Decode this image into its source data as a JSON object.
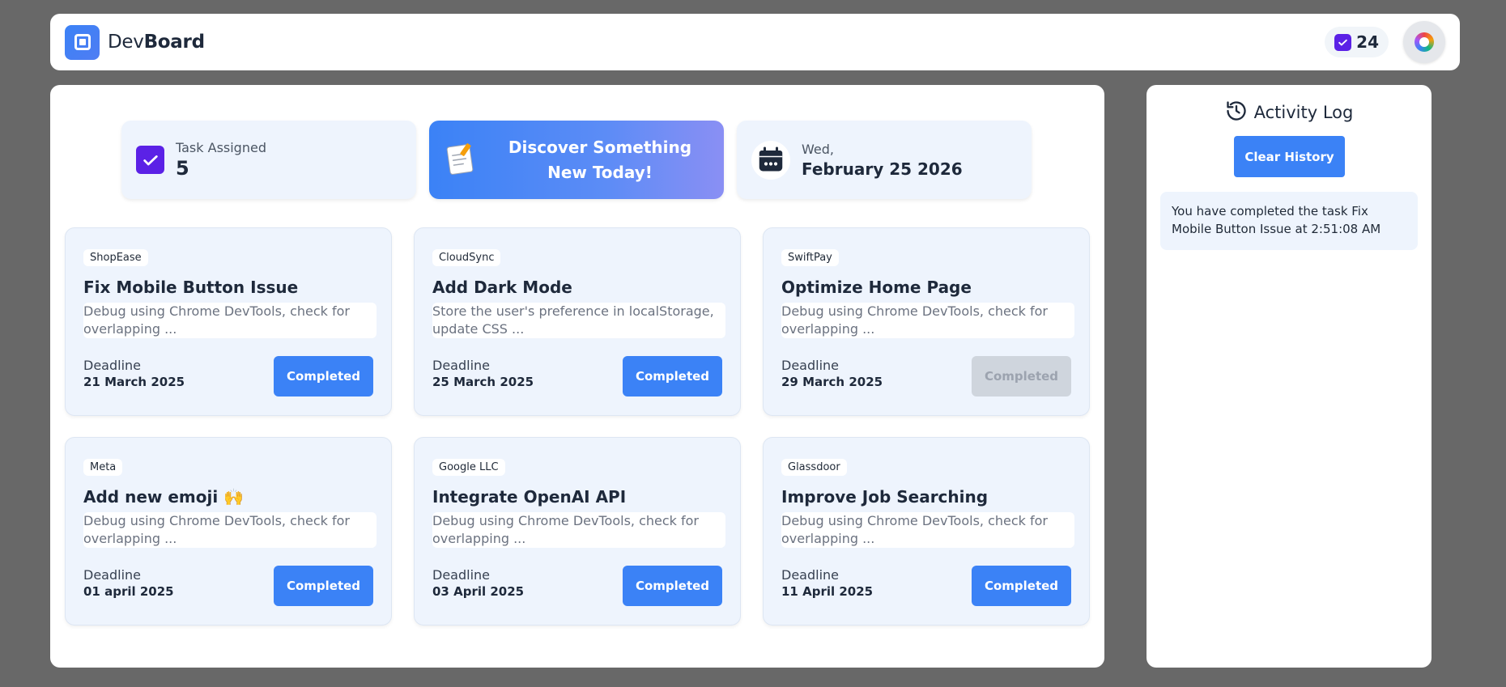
{
  "app": {
    "brand_prefix": "Dev",
    "brand_suffix": "Board",
    "completed_count": "24"
  },
  "colors": {
    "accent": "#3b82f6",
    "check": "#5b21e6",
    "card_bg": "#eef4fd",
    "disabled": "#cfd5dd"
  },
  "stats": {
    "task_assigned_label": "Task Assigned",
    "task_assigned_value": "5",
    "promo_text": "Discover Something New Today!",
    "date_day": "Wed,",
    "date_full": "February 25 2026"
  },
  "deadline_label": "Deadline",
  "tasks": [
    {
      "company": "ShopEase",
      "title": "Fix Mobile Button Issue",
      "desc": "Debug using Chrome DevTools, check for overlapping ...",
      "deadline": "21 March 2025",
      "button": "Completed",
      "disabled": false
    },
    {
      "company": "CloudSync",
      "title": "Add Dark Mode",
      "desc": "Store the user's preference in localStorage, update CSS ...",
      "deadline": "25 March 2025",
      "button": "Completed",
      "disabled": false
    },
    {
      "company": "SwiftPay",
      "title": "Optimize Home Page",
      "desc": "Debug using Chrome DevTools, check for overlapping ...",
      "deadline": "29 March 2025",
      "button": "Completed",
      "disabled": true
    },
    {
      "company": "Meta",
      "title": "Add new emoji 🙌",
      "desc": "Debug using Chrome DevTools, check for overlapping ...",
      "deadline": "01 april 2025",
      "button": "Completed",
      "disabled": false
    },
    {
      "company": "Google LLC",
      "title": "Integrate OpenAI API",
      "desc": "Debug using Chrome DevTools, check for overlapping ...",
      "deadline": "03 April 2025",
      "button": "Completed",
      "disabled": false
    },
    {
      "company": "Glassdoor",
      "title": "Improve Job Searching",
      "desc": "Debug using Chrome DevTools, check for overlapping ...",
      "deadline": "11 April 2025",
      "button": "Completed",
      "disabled": false
    }
  ],
  "activity": {
    "title": "Activity Log",
    "clear_label": "Clear History",
    "entries": [
      "You have completed the task Fix Mobile Button Issue at 2:51:08 AM"
    ]
  }
}
